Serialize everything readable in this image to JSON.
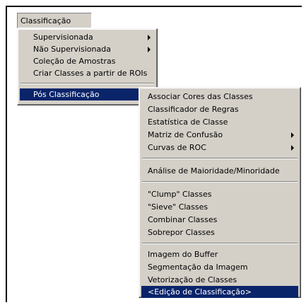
{
  "menubar": {
    "classificacao": "Classificação"
  },
  "menu_classificacao": {
    "supervisionada": "Supervisionada",
    "nao_supervisionada": "Não Supervisionada",
    "colecao_amostras": "Coleção de Amostras",
    "criar_classes_rois": "Criar Classes a partir de ROIs",
    "pos_classificacao": "Pós Classificação"
  },
  "menu_pos_classificacao": {
    "associar_cores": "Associar Cores das Classes",
    "classificador_regras": "Classificador de Regras",
    "estatistica_classe": "Estatística de Classe",
    "matriz_confusao": "Matriz de Confusão",
    "curvas_roc": "Curvas de ROC",
    "analise_maioridade": "Análise de Maioridade/Minoridade",
    "clump_classes": "\"Clump\" Classes",
    "sieve_classes": "\"Sieve\" Classes",
    "combinar_classes": "Combinar Classes",
    "sobrepor_classes": "Sobrepor Classes",
    "imagem_buffer": "Imagem do Buffer",
    "segmentacao_imagem": "Segmentação da Imagem",
    "vetorizacao_classes": "Vetorização de Classes",
    "edicao_classificacao": "<Edição de Classificação>"
  },
  "colors": {
    "menu_bg": "#d4d0c8",
    "highlight": "#0a246a",
    "highlight_text": "#ffffff"
  },
  "icons": {
    "submenu": "arrow-right-icon"
  }
}
